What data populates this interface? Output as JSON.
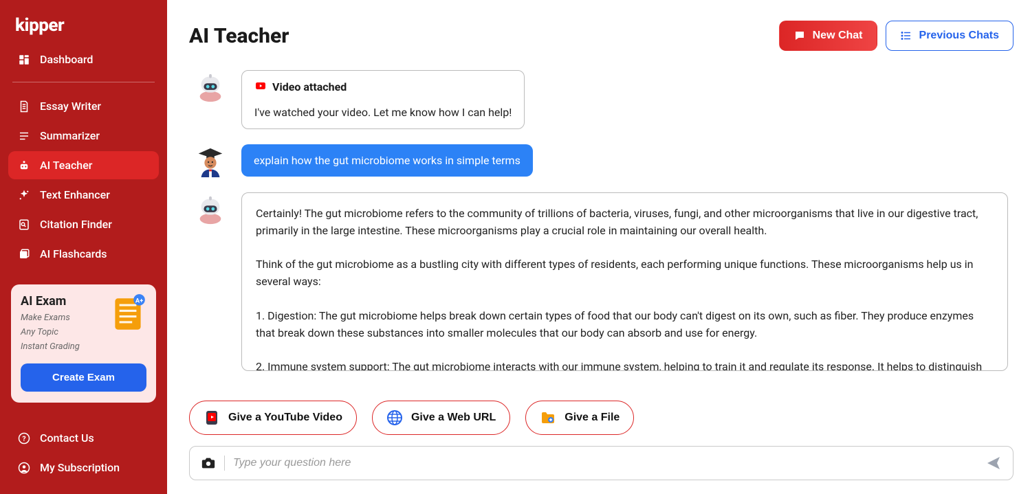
{
  "brand": "kipper",
  "sidebar": {
    "items": [
      {
        "label": "Dashboard",
        "icon": "dashboard"
      },
      {
        "label": "Essay Writer",
        "icon": "doc"
      },
      {
        "label": "Summarizer",
        "icon": "lines"
      },
      {
        "label": "AI Teacher",
        "icon": "robot",
        "active": true
      },
      {
        "label": "Text Enhancer",
        "icon": "sparkle"
      },
      {
        "label": "Citation Finder",
        "icon": "cite"
      },
      {
        "label": "AI Flashcards",
        "icon": "cards"
      }
    ],
    "examCard": {
      "title": "AI Exam",
      "line1": "Make Exams",
      "line2": "Any Topic",
      "line3": "Instant Grading",
      "cta": "Create Exam"
    },
    "bottom": [
      {
        "label": "Contact Us",
        "icon": "help"
      },
      {
        "label": "My Subscription",
        "icon": "person"
      }
    ]
  },
  "page": {
    "title": "AI Teacher",
    "newChat": "New Chat",
    "prevChats": "Previous Chats"
  },
  "chat": {
    "msg0": {
      "attachLabel": "Video attached",
      "body": "I've watched your video. Let me know how I can help!"
    },
    "msg1": {
      "text": "explain how the gut microbiome works in simple terms"
    },
    "msg2": {
      "text": "Certainly! The gut microbiome refers to the community of trillions of bacteria, viruses, fungi, and other microorganisms that live in our digestive tract, primarily in the large intestine. These microorganisms play a crucial role in maintaining our overall health.\n\nThink of the gut microbiome as a bustling city with different types of residents, each performing unique functions. These microorganisms help us in several ways:\n\n1. Digestion: The gut microbiome helps break down certain types of food that our body can't digest on its own, such as fiber. They produce enzymes that break down these substances into smaller molecules that our body can absorb and use for energy.\n\n2. Immune system support: The gut microbiome interacts with our immune system, helping to train it and regulate its response. It helps to distinguish between harmful and harmless substances, reducing the risk of autoimmune diseases or allergies."
    }
  },
  "chips": {
    "youtube": "Give a YouTube Video",
    "url": "Give a Web URL",
    "file": "Give a File"
  },
  "composer": {
    "placeholder": "Type your question here"
  }
}
